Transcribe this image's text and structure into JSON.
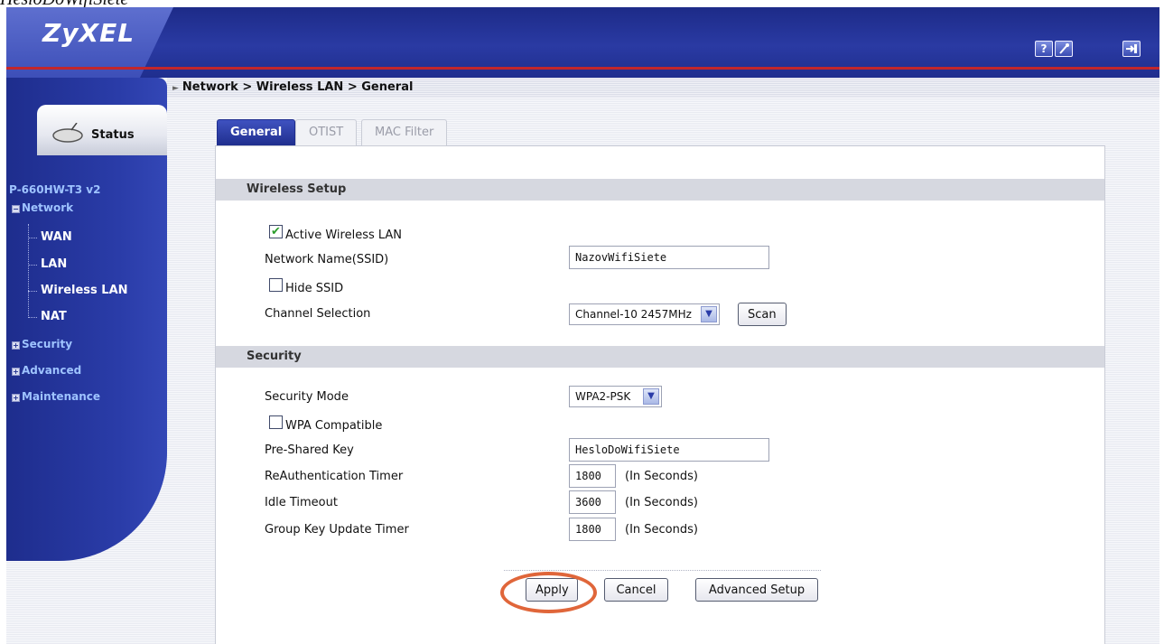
{
  "caption": "HesloDoWifiSiete",
  "brand": {
    "logo": "ZyXEL",
    "accent_color": "#1f2e8e",
    "redline_color": "#c2262b"
  },
  "header": {
    "help_icon": "help-icon",
    "wizard_icon": "wizard-icon",
    "logout_icon": "logout-icon",
    "help_glyph": "?"
  },
  "breadcrumb": "Network > Wireless LAN > General",
  "sidebar": {
    "status_label": "Status",
    "model": "P-660HW-T3 v2",
    "items": [
      {
        "label": "Network",
        "expanded": true
      },
      {
        "label": "WAN"
      },
      {
        "label": "LAN"
      },
      {
        "label": "Wireless LAN"
      },
      {
        "label": "NAT"
      },
      {
        "label": "Security",
        "expanded": false
      },
      {
        "label": "Advanced",
        "expanded": false
      },
      {
        "label": "Maintenance",
        "expanded": false
      }
    ]
  },
  "tabs": [
    {
      "label": "General",
      "active": true
    },
    {
      "label": "OTIST",
      "active": false
    },
    {
      "label": "MAC Filter",
      "active": false
    }
  ],
  "wireless": {
    "section_title": "Wireless Setup",
    "active_label": "Active Wireless LAN",
    "active_checked": true,
    "ssid_label": "Network Name(SSID)",
    "ssid_value": "NazovWifiSiete",
    "hide_label": "Hide SSID",
    "hide_checked": false,
    "channel_label": "Channel Selection",
    "channel_value": "Channel-10 2457MHz",
    "scan_label": "Scan"
  },
  "security": {
    "section_title": "Security",
    "mode_label": "Security Mode",
    "mode_value": "WPA2-PSK",
    "wpa_label": "WPA Compatible",
    "wpa_checked": false,
    "psk_label": "Pre-Shared Key",
    "psk_value": "HesloDoWifiSiete",
    "reauth_label": "ReAuthentication Timer",
    "reauth_value": "1800",
    "idle_label": "Idle Timeout",
    "idle_value": "3600",
    "group_label": "Group Key Update Timer",
    "group_value": "1800",
    "unit": "(In Seconds)"
  },
  "buttons": {
    "apply": "Apply",
    "cancel": "Cancel",
    "advanced": "Advanced Setup"
  },
  "check_glyph": "✔"
}
